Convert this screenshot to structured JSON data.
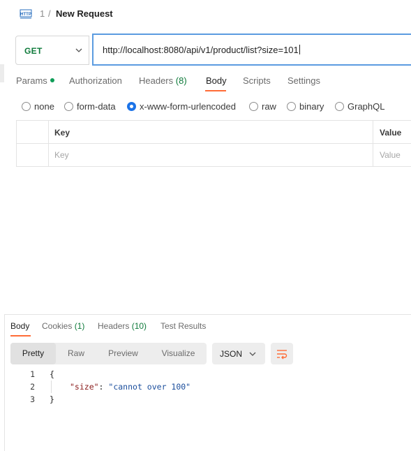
{
  "header": {
    "icon": "http-icon",
    "breadcrumb_num": "1",
    "breadcrumb_sep": "/",
    "title": "New Request"
  },
  "request": {
    "method": "GET",
    "method_color": "#0e7a3a",
    "url": "http://localhost:8080/api/v1/product/list?size=101"
  },
  "request_tabs": {
    "params": "Params",
    "authorization": "Authorization",
    "headers": "Headers",
    "headers_count": "(8)",
    "body": "Body",
    "scripts": "Scripts",
    "settings": "Settings",
    "active": "Body"
  },
  "body_types": {
    "none": "none",
    "form_data": "form-data",
    "urlencoded": "x-www-form-urlencoded",
    "raw": "raw",
    "binary": "binary",
    "graphql": "GraphQL",
    "selected": "x-www-form-urlencoded"
  },
  "kv_table": {
    "key_header": "Key",
    "value_header": "Value",
    "key_placeholder": "Key",
    "value_placeholder": "Value"
  },
  "response_tabs": {
    "body": "Body",
    "cookies": "Cookies",
    "cookies_count": "(1)",
    "headers": "Headers",
    "headers_count": "(10)",
    "test_results": "Test Results",
    "active": "Body"
  },
  "view_modes": {
    "pretty": "Pretty",
    "raw": "Raw",
    "preview": "Preview",
    "visualize": "Visualize",
    "active": "Pretty"
  },
  "format": "JSON",
  "response_code": {
    "line_numbers": [
      "1",
      "2",
      "3"
    ],
    "open_brace": "{",
    "key": "\"size\"",
    "colon": ": ",
    "value": "\"cannot over 100\"",
    "close_brace": "}"
  },
  "colors": {
    "accent": "#ff6c37",
    "url_focus": "#5b9be0",
    "radio_selected": "#1c73e8",
    "params_dot": "#0f9d58"
  }
}
